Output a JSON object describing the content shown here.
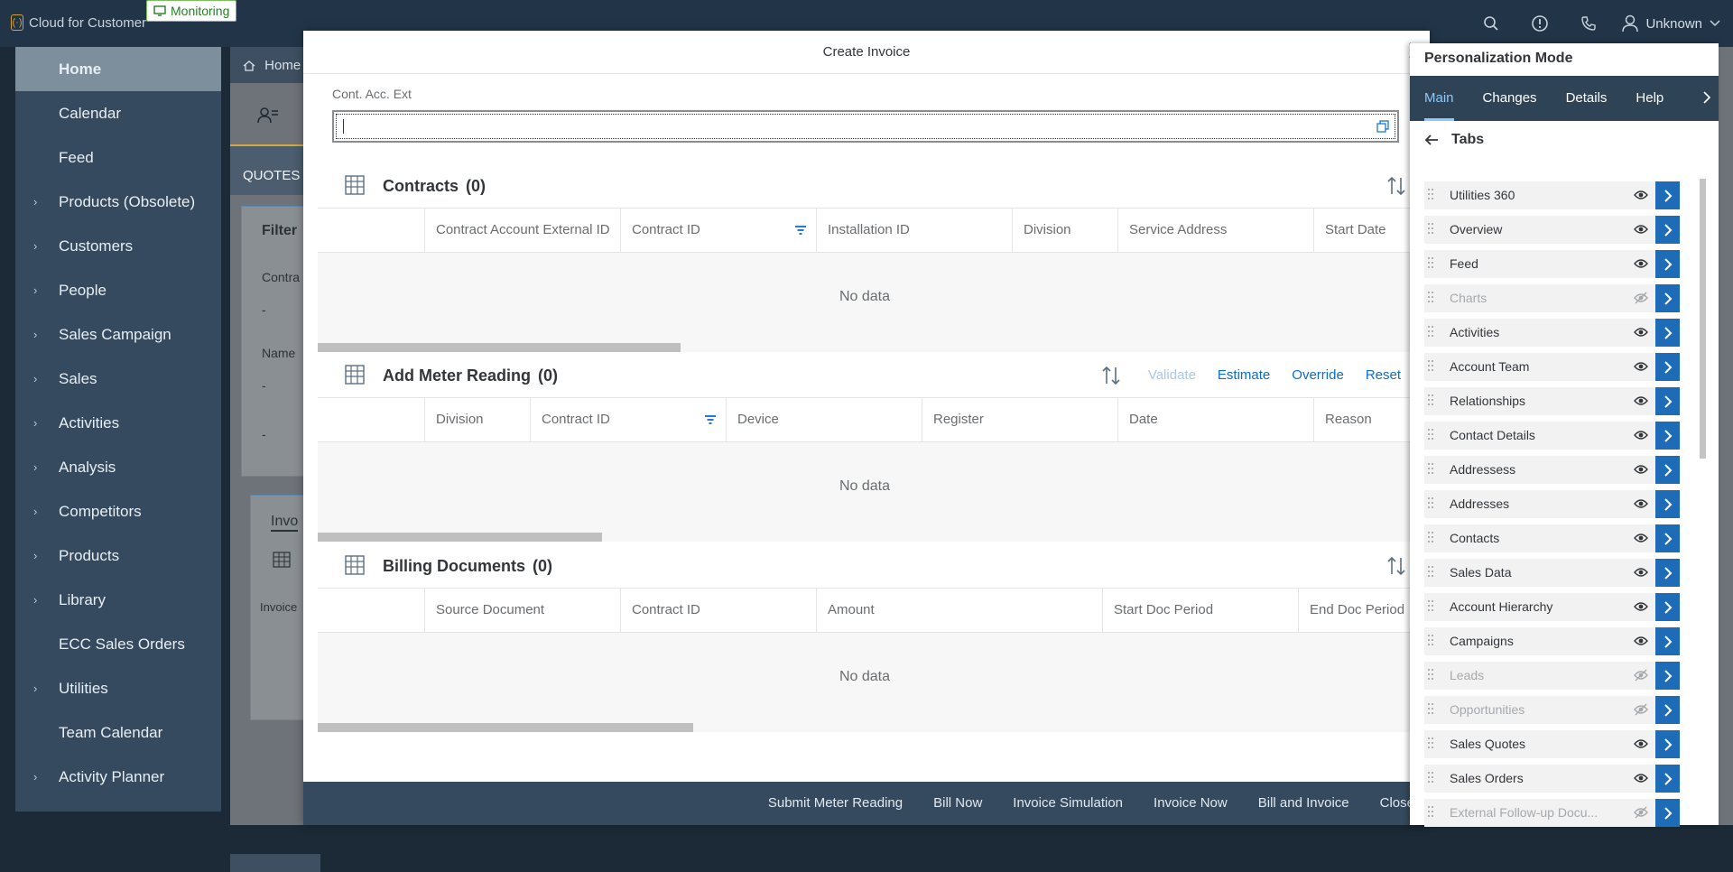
{
  "shell": {
    "app_name": "Cloud for Customer",
    "monitoring_badge": "Monitoring",
    "user_name": "Unknown"
  },
  "nav": {
    "items": [
      {
        "label": "Home",
        "active": true,
        "expandable": false
      },
      {
        "label": "Calendar",
        "expandable": false
      },
      {
        "label": "Feed",
        "expandable": false
      },
      {
        "label": "Products (Obsolete)",
        "expandable": true
      },
      {
        "label": "Customers",
        "expandable": true
      },
      {
        "label": "People",
        "expandable": true
      },
      {
        "label": "Sales Campaign",
        "expandable": true
      },
      {
        "label": "Sales",
        "expandable": true
      },
      {
        "label": "Activities",
        "expandable": true
      },
      {
        "label": "Analysis",
        "expandable": true
      },
      {
        "label": "Competitors",
        "expandable": true
      },
      {
        "label": "Products",
        "expandable": true
      },
      {
        "label": "Library",
        "expandable": true
      },
      {
        "label": "ECC Sales Orders",
        "expandable": false
      },
      {
        "label": "Utilities",
        "expandable": true
      },
      {
        "label": "Team Calendar",
        "expandable": false
      },
      {
        "label": "Activity Planner",
        "expandable": true
      }
    ]
  },
  "background": {
    "breadcrumb": "Home",
    "tab_label": "QUOTES",
    "filter_label": "Filter",
    "field1_label": "Contra",
    "field1_value": "-",
    "field2_label": "Name",
    "field2_value": "-",
    "field3_value": "-",
    "invoice_tab": "Invo",
    "invoice_text": "Invoice"
  },
  "dialog": {
    "title": "Create Invoice",
    "field_label": "Cont. Acc. Ext",
    "field_value": "",
    "sections": {
      "contracts": {
        "title": "Contracts",
        "count": "(0)",
        "columns": [
          "Contract Account External ID",
          "Contract ID",
          "Installation ID",
          "Division",
          "Service Address",
          "Start Date"
        ],
        "no_data": "No data"
      },
      "meter": {
        "title": "Add Meter Reading",
        "count": "(0)",
        "actions": [
          "Validate",
          "Estimate",
          "Override",
          "Reset"
        ],
        "columns": [
          "Division",
          "Contract ID",
          "Device",
          "Register",
          "Date",
          "Reason"
        ],
        "no_data": "No data"
      },
      "billing": {
        "title": "Billing Documents",
        "count": "(0)",
        "columns": [
          "Source Document",
          "Contract ID",
          "Amount",
          "Start Doc Period",
          "End Doc Period"
        ],
        "no_data": "No data"
      }
    },
    "footer_buttons": [
      "Submit Meter Reading",
      "Bill Now",
      "Invoice Simulation",
      "Invoice Now",
      "Bill and Invoice",
      "Close"
    ]
  },
  "personalization": {
    "title": "Personalization Mode",
    "tabs": [
      "Main",
      "Changes",
      "Details",
      "Help"
    ],
    "active_tab": "Main",
    "subheader": "Tabs",
    "items": [
      {
        "label": "Utilities 360",
        "visible": true
      },
      {
        "label": "Overview",
        "visible": true
      },
      {
        "label": "Feed",
        "visible": true
      },
      {
        "label": "Charts",
        "visible": false
      },
      {
        "label": "Activities",
        "visible": true
      },
      {
        "label": "Account Team",
        "visible": true
      },
      {
        "label": "Relationships",
        "visible": true
      },
      {
        "label": "Contact Details",
        "visible": true
      },
      {
        "label": "Addressess",
        "visible": true
      },
      {
        "label": "Addresses",
        "visible": true
      },
      {
        "label": "Contacts",
        "visible": true
      },
      {
        "label": "Sales Data",
        "visible": true
      },
      {
        "label": "Account Hierarchy",
        "visible": true
      },
      {
        "label": "Campaigns",
        "visible": true
      },
      {
        "label": "Leads",
        "visible": false
      },
      {
        "label": "Opportunities",
        "visible": false
      },
      {
        "label": "Sales Quotes",
        "visible": true
      },
      {
        "label": "Sales Orders",
        "visible": true
      },
      {
        "label": "External Follow-up Docu...",
        "visible": false
      }
    ]
  },
  "colors": {
    "shell": "#223548",
    "accent": "#0a6ed1",
    "go_button": "#1e6bb8",
    "footer": "#354a5f"
  },
  "icons": [
    "search-icon",
    "alert-icon",
    "phone-icon",
    "user-icon",
    "chevron-down-icon",
    "close-icon",
    "value-help-icon",
    "table-icon",
    "sort-icon",
    "filter-icon",
    "eye-icon",
    "eye-slash-icon",
    "chevron-right-icon",
    "back-arrow-icon",
    "grip-icon",
    "home-icon"
  ]
}
